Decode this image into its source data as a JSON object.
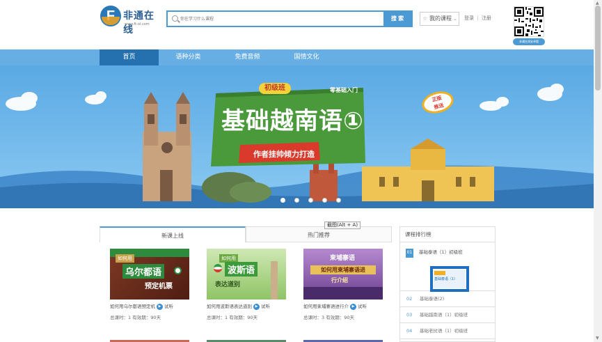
{
  "header": {
    "logo_text": "非通在线",
    "logo_sub": "www.ft-ol.com",
    "search": {
      "placeholder": "你在学习什么课程",
      "button": "搜 索"
    },
    "my_courses": "我的课程",
    "login": "登录",
    "separator": "|",
    "register": "注册",
    "qr_caption": "非通在线安卓版"
  },
  "nav": {
    "items": [
      {
        "label": "首页"
      },
      {
        "label": "语种分类"
      },
      {
        "label": "免费音频"
      },
      {
        "label": "国情文化"
      }
    ]
  },
  "banner": {
    "level": "初级班",
    "tag": "零基础入门",
    "title": "基础越南语①",
    "subtitle": "作者挂帅倾力打造",
    "badge_line1": "正版",
    "badge_line2": "推送",
    "active_dot": 0,
    "dot_count": 5
  },
  "tooltip": "截图(Alt + A)",
  "tabs": [
    {
      "label": "新课上线"
    },
    {
      "label": "热门推荐"
    }
  ],
  "cards": [
    {
      "thumb_line1": "如何用",
      "thumb_line2": "乌尔都语",
      "thumb_line3": "预定机票",
      "title": "如何用乌尔都语预定机",
      "trial": "试听",
      "meta": "总课时：1  有效期：90天",
      "color": "#6d2e1f"
    },
    {
      "thumb_line1": "如何用",
      "thumb_line2": "波斯语",
      "thumb_line3": "表达道别",
      "title": "如何用波斯语表达道别",
      "trial": "试听",
      "meta": "总课时：1  有效期：90天",
      "color": "#7dbf4a"
    },
    {
      "thumb_line1": "柬埔寨语",
      "thumb_line2": "如何用柬埔寨语进",
      "thumb_line3": "行介绍",
      "title": "如何用柬埔寨语进行介",
      "trial": "试听",
      "meta": "总课时：3  有效期：90天",
      "color": "#8a62a8"
    }
  ],
  "ranking": {
    "heading": "课程排行榜",
    "first": {
      "num": "01",
      "label": "基础泰语（1）初级班",
      "thumb_text": "基础泰语（1）"
    },
    "items": [
      {
        "num": "02",
        "label": "基础泰语(2)"
      },
      {
        "num": "03",
        "label": "基础越南语（1）初级班"
      },
      {
        "num": "04",
        "label": "基础老挝语（1）初级班"
      }
    ]
  }
}
